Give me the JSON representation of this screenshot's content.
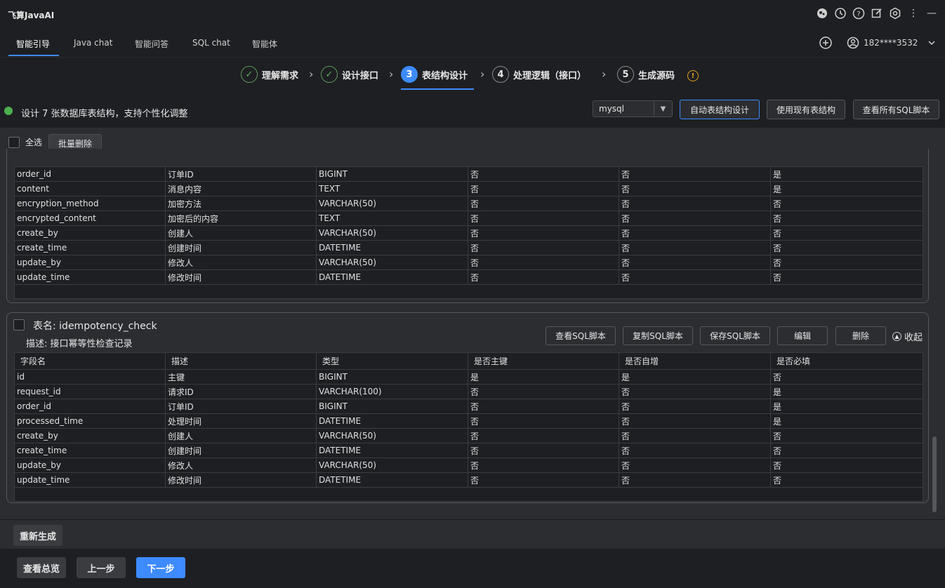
{
  "app": {
    "title": "飞算JavaAI"
  },
  "tabs": [
    {
      "label": "智能引导",
      "active": true
    },
    {
      "label": "Java chat"
    },
    {
      "label": "智能问答"
    },
    {
      "label": "SQL chat"
    },
    {
      "label": "智能体"
    }
  ],
  "user": {
    "id": "182****3532"
  },
  "steps": [
    {
      "num": "✓",
      "label": "理解需求",
      "state": "done"
    },
    {
      "num": "✓",
      "label": "设计接口",
      "state": "done"
    },
    {
      "num": "3",
      "label": "表结构设计",
      "state": "current"
    },
    {
      "num": "4",
      "label": "处理逻辑（接口）",
      "state": "todo"
    },
    {
      "num": "5",
      "label": "生成源码",
      "state": "todo"
    }
  ],
  "summary": {
    "text": "设计 7 张数据库表结构，支持个性化调整",
    "db_type": "mysql",
    "buttons": {
      "auto": "自动表结构设计",
      "use_existing": "使用现有表结构",
      "view_all": "查看所有SQL脚本"
    }
  },
  "toolbar": {
    "select_all": "全选",
    "batch_delete": "批量删除"
  },
  "table1": {
    "rows": [
      [
        "order_id",
        "订单ID",
        "BIGINT",
        "否",
        "否",
        "是"
      ],
      [
        "content",
        "消息内容",
        "TEXT",
        "否",
        "否",
        "是"
      ],
      [
        "encryption_method",
        "加密方法",
        "VARCHAR(50)",
        "否",
        "否",
        "否"
      ],
      [
        "encrypted_content",
        "加密后的内容",
        "TEXT",
        "否",
        "否",
        "否"
      ],
      [
        "create_by",
        "创建人",
        "VARCHAR(50)",
        "否",
        "否",
        "否"
      ],
      [
        "create_time",
        "创建时间",
        "DATETIME",
        "否",
        "否",
        "否"
      ],
      [
        "update_by",
        "修改人",
        "VARCHAR(50)",
        "否",
        "否",
        "否"
      ],
      [
        "update_time",
        "修改时间",
        "DATETIME",
        "否",
        "否",
        "否"
      ]
    ]
  },
  "table2": {
    "name_label": "表名: idempotency_check",
    "desc_label": "描述: 接口幂等性检查记录",
    "buttons": {
      "view_sql": "查看SQL脚本",
      "copy_sql": "复制SQL脚本",
      "save_sql": "保存SQL脚本",
      "edit": "编辑",
      "delete": "删除",
      "collapse": "收起"
    },
    "headers": [
      "字段名",
      "描述",
      "类型",
      "是否主键",
      "是否自增",
      "是否必填"
    ],
    "rows": [
      [
        "id",
        "主键",
        "BIGINT",
        "是",
        "是",
        "否"
      ],
      [
        "request_id",
        "请求ID",
        "VARCHAR(100)",
        "否",
        "否",
        "是"
      ],
      [
        "order_id",
        "订单ID",
        "BIGINT",
        "否",
        "否",
        "是"
      ],
      [
        "processed_time",
        "处理时间",
        "DATETIME",
        "否",
        "否",
        "是"
      ],
      [
        "create_by",
        "创建人",
        "VARCHAR(50)",
        "否",
        "否",
        "否"
      ],
      [
        "create_time",
        "创建时间",
        "DATETIME",
        "否",
        "否",
        "否"
      ],
      [
        "update_by",
        "修改人",
        "VARCHAR(50)",
        "否",
        "否",
        "否"
      ],
      [
        "update_time",
        "修改时间",
        "DATETIME",
        "否",
        "否",
        "否"
      ]
    ]
  },
  "regenerate": "重新生成",
  "footer": {
    "overview": "查看总览",
    "prev": "上一步",
    "next": "下一步"
  },
  "colors": {
    "accent": "#3d8bff",
    "success": "#4caf50",
    "warning": "#e0a020"
  }
}
